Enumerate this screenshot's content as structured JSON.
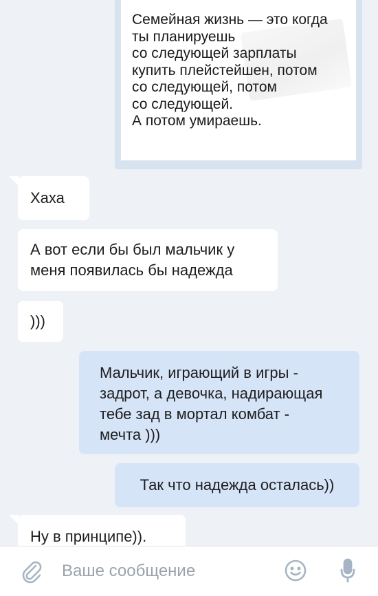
{
  "messages": {
    "image_quote": {
      "lines": [
        "Семейная жизнь — это когда",
        "ты планируешь",
        "со следующей зарплаты",
        "купить плейстейшен, потом",
        "со следующей, потом",
        "со следующей.",
        "А потом умираешь."
      ]
    },
    "haha": "Хаха",
    "boy_hope": {
      "line1": "А вот если бы был мальчик у",
      "line2": "меня появилась бы надежда"
    },
    "smile": ")))",
    "boy_game": {
      "line1": "Мальчик, играющий в игры -",
      "line2": "задрот, а девочка, надирающая",
      "line3": "тебе зад в мортал комбат -",
      "line4": "мечта )))"
    },
    "hope_left": "Так что надежда осталась))",
    "last": "Ну в принципе))."
  },
  "composer": {
    "placeholder": "Ваше сообщение",
    "icons": [
      "attach-icon",
      "emoji-icon",
      "microphone-icon"
    ]
  },
  "colors": {
    "background": "#eef1f6",
    "incoming": "#ffffff",
    "outgoing": "#d6e4f7",
    "icon": "#a7b4c4"
  }
}
